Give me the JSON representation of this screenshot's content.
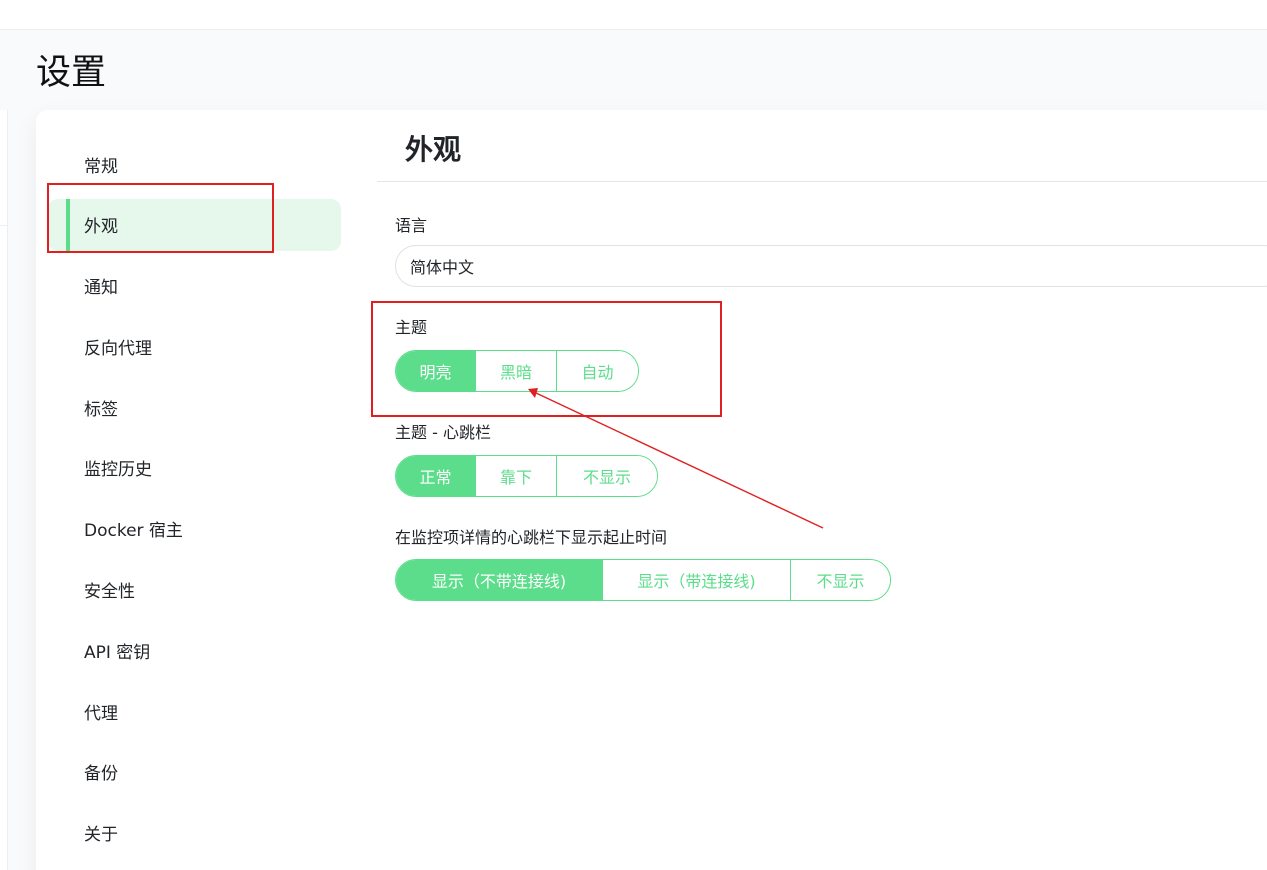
{
  "page": {
    "title": "设置"
  },
  "sidebar": {
    "items": [
      {
        "label": "常规"
      },
      {
        "label": "外观"
      },
      {
        "label": "通知"
      },
      {
        "label": "反向代理"
      },
      {
        "label": "标签"
      },
      {
        "label": "监控历史"
      },
      {
        "label": "Docker 宿主"
      },
      {
        "label": "安全性"
      },
      {
        "label": "API 密钥"
      },
      {
        "label": "代理"
      },
      {
        "label": "备份"
      },
      {
        "label": "关于"
      }
    ],
    "active_index": 1
  },
  "main": {
    "section_title": "外观",
    "language": {
      "label": "语言",
      "value": "简体中文"
    },
    "theme": {
      "label": "主题",
      "options": [
        "明亮",
        "黑暗",
        "自动"
      ],
      "selected": "明亮"
    },
    "heartbeat_bar": {
      "label": "主题 - 心跳栏",
      "options": [
        "正常",
        "靠下",
        "不显示"
      ],
      "selected": "正常"
    },
    "timeline": {
      "label": "在监控项详情的心跳栏下显示起止时间",
      "options": [
        "显示（不带连接线)",
        "显示（带连接线)",
        "不显示"
      ],
      "selected": "显示（不带连接线)"
    }
  },
  "colors": {
    "accent": "#5cdd8b",
    "annotation": "#e02020"
  }
}
